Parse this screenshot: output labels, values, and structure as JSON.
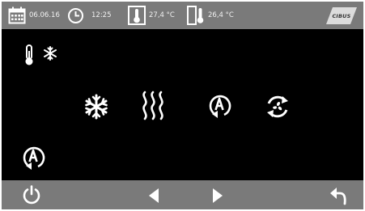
{
  "status_bar": {
    "date": "06.06.16",
    "time": "12:25",
    "temperature_1": "27,4 °C",
    "temperature_2": "26,4 °C",
    "logo_text": "CIBUS"
  },
  "main": {
    "mode_indicator_icon": "thermometer-snowflake-icon",
    "mode_buttons": [
      "snowflake-icon",
      "heat-waves-icon",
      "auto-mode-icon",
      "fan-recirculation-icon"
    ],
    "bottom_left_icon": "auto-mode-icon"
  },
  "bottom_bar": {
    "buttons": [
      "power-icon",
      "arrow-left-icon",
      "arrow-right-icon",
      "back-icon"
    ]
  },
  "colors": {
    "bar_background": "#7a7a7a",
    "screen_background": "#000000",
    "foreground": "#ffffff"
  }
}
